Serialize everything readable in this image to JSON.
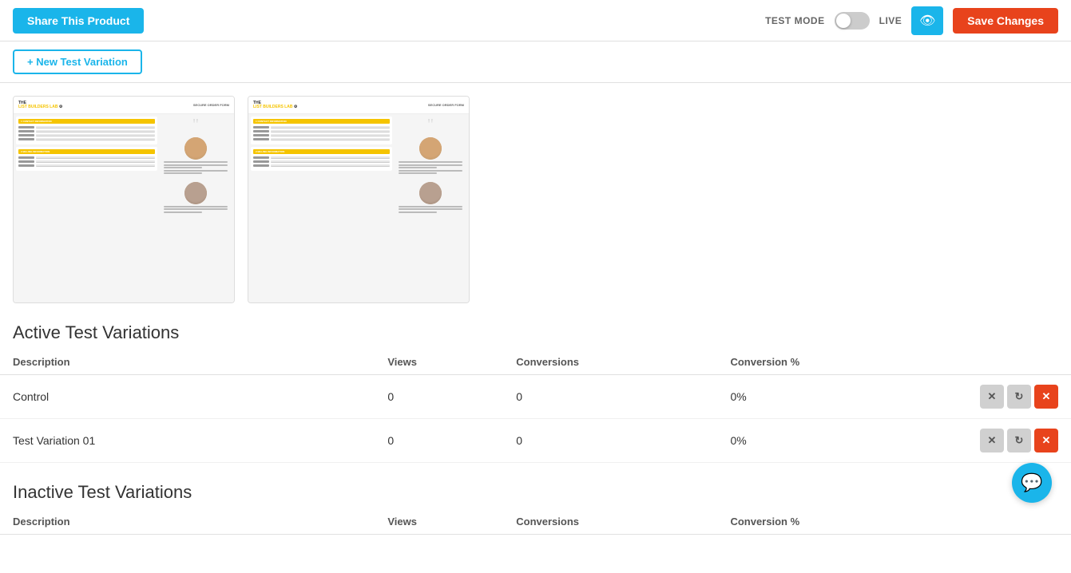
{
  "header": {
    "share_label": "Share This Product",
    "test_mode_label": "TEST MODE",
    "live_label": "LIVE",
    "eye_icon": "👁",
    "save_label": "Save Changes",
    "toggle_active": false
  },
  "new_variation": {
    "button_label": "+ New Test Variation"
  },
  "active_section": {
    "heading": "Active Test Variations",
    "columns": {
      "description": "Description",
      "views": "Views",
      "conversions": "Conversions",
      "conversion_pct": "Conversion %"
    },
    "rows": [
      {
        "description": "Control",
        "views": "0",
        "conversions": "0",
        "conversion_pct": "0%"
      },
      {
        "description": "Test Variation 01",
        "views": "0",
        "conversions": "0",
        "conversion_pct": "0%"
      }
    ]
  },
  "inactive_section": {
    "heading": "Inactive Test Variations",
    "columns": {
      "description": "Description",
      "views": "Views",
      "conversions": "Conversions",
      "conversion_pct": "Conversion %"
    },
    "rows": []
  },
  "icons": {
    "x_icon": "✕",
    "refresh_icon": "↻",
    "delete_icon": "✕",
    "chat_icon": "💬"
  }
}
